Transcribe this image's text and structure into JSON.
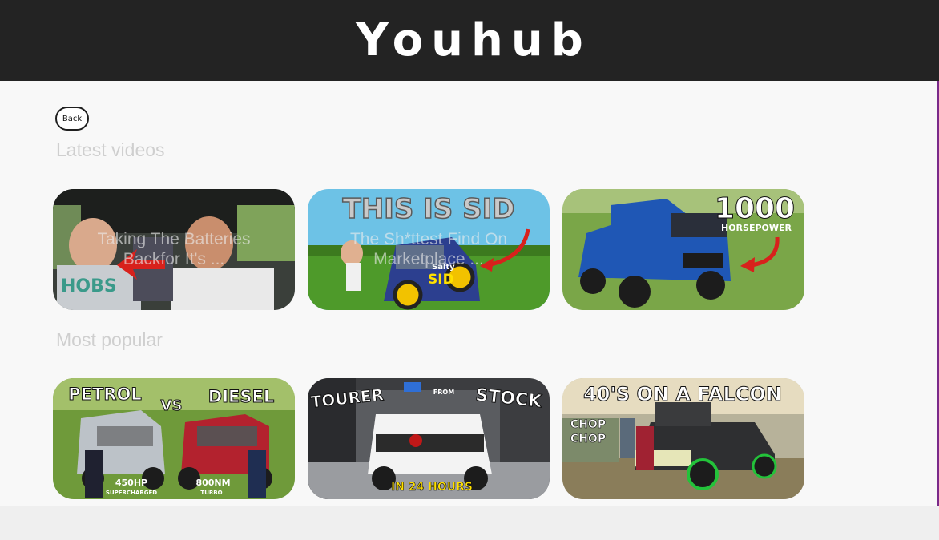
{
  "app": {
    "title": "Youhub"
  },
  "nav": {
    "back_label": "Back"
  },
  "sections": {
    "latest": {
      "title": "Latest videos",
      "videos": [
        {
          "overlay": "Taking The Batteries Backfor It's ...",
          "thumb_text": []
        },
        {
          "overlay": "The Sh*ttest Find On Marketplace ...",
          "thumb_text": [
            "THIS IS SID",
            "Salty",
            "SID"
          ]
        },
        {
          "overlay": "",
          "thumb_text": [
            "1000",
            "HORSEPOWER"
          ]
        }
      ]
    },
    "popular": {
      "title": "Most popular",
      "videos": [
        {
          "thumb_text": [
            "PETROL",
            "VS",
            "DIESEL",
            "450HP",
            "SUPERCHARGED",
            "800NM",
            "TURBO"
          ]
        },
        {
          "thumb_text": [
            "TOURER",
            "FROM",
            "STOCK",
            "IN 24 HOURS"
          ]
        },
        {
          "thumb_text": [
            "40'S ON A FALCON",
            "CHOP",
            "CHOP"
          ]
        }
      ]
    }
  },
  "colors": {
    "header_bg": "#232323",
    "accent_red": "#d8211c",
    "grass": "#5e9a2e"
  }
}
